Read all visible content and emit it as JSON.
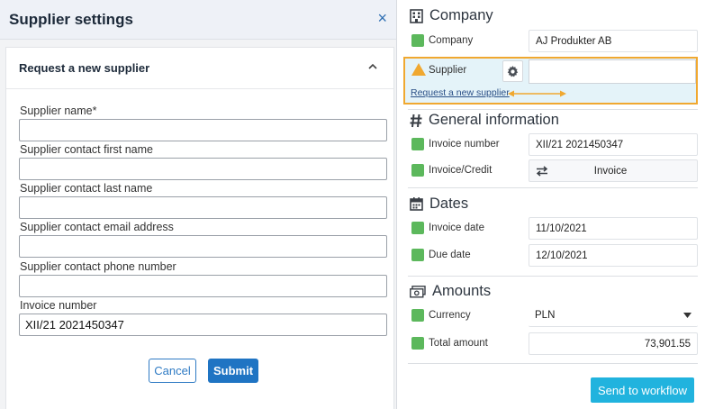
{
  "left_panel": {
    "title": "Supplier settings",
    "close_symbol": "×",
    "card_title": "Request a new supplier",
    "fields": [
      {
        "label": "Supplier name*",
        "value": ""
      },
      {
        "label": "Supplier contact first name",
        "value": ""
      },
      {
        "label": "Supplier contact last name",
        "value": ""
      },
      {
        "label": "Supplier contact email address",
        "value": ""
      },
      {
        "label": "Supplier contact phone number",
        "value": ""
      },
      {
        "label": "Invoice number",
        "value": "XII/21 2021450347"
      }
    ],
    "cancel_label": "Cancel",
    "submit_label": "Submit"
  },
  "right_panel": {
    "company": {
      "heading": "Company",
      "company_label": "Company",
      "company_value": "AJ Produkter AB",
      "supplier_label": "Supplier",
      "supplier_value": "",
      "request_link": "Request a new supplier"
    },
    "general": {
      "heading": "General information",
      "invoice_number_label": "Invoice number",
      "invoice_number_value": "XII/21 2021450347",
      "invoice_credit_label": "Invoice/Credit",
      "invoice_credit_value": "Invoice"
    },
    "dates": {
      "heading": "Dates",
      "invoice_date_label": "Invoice date",
      "invoice_date_value": "11/10/2021",
      "due_date_label": "Due date",
      "due_date_value": "12/10/2021"
    },
    "amounts": {
      "heading": "Amounts",
      "currency_label": "Currency",
      "currency_value": "PLN",
      "total_label": "Total amount",
      "total_value": "73,901.55"
    },
    "workflow_label": "Send to workflow"
  },
  "colors": {
    "status_ok": "#5cb85c",
    "warning": "#f0a830",
    "primary": "#1f74c3",
    "workflow": "#21b3de"
  },
  "icons": [
    "close-icon",
    "chevron-up-icon",
    "building-icon",
    "warning-icon",
    "gear-icon",
    "hash-icon",
    "swap-arrows-icon",
    "calendar-icon",
    "money-icon",
    "caret-down-icon",
    "double-arrow-icon"
  ]
}
